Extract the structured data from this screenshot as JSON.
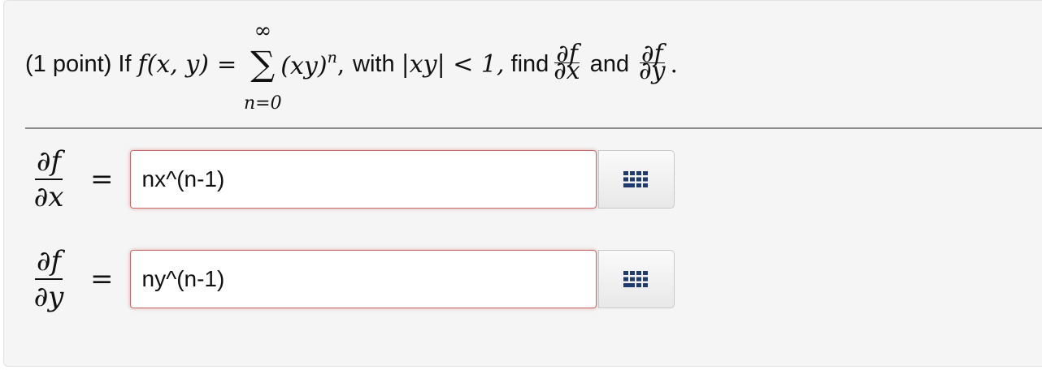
{
  "problem": {
    "points": "(1 point)",
    "if_text": "If",
    "lhs": "f(x, y)",
    "equals": "=",
    "sum_upper": "∞",
    "sum_lower": "n=0",
    "term_base": "(xy)",
    "term_exp": "n",
    "comma": ",",
    "with_text": "with",
    "condition": "|xy| < 1,",
    "find_text": "find",
    "and_text": "and",
    "period": ".",
    "frac_x": {
      "num": "∂f",
      "den": "∂x"
    },
    "frac_y": {
      "num": "∂f",
      "den": "∂y"
    }
  },
  "answers": [
    {
      "label_num": "∂f",
      "label_den": "∂x",
      "equals": "=",
      "value": "nx^(n-1)",
      "palette_icon": "equation-editor-grid-icon"
    },
    {
      "label_num": "∂f",
      "label_den": "∂y",
      "equals": "=",
      "value": "ny^(n-1)",
      "palette_icon": "equation-editor-grid-icon"
    }
  ],
  "colors": {
    "panel_bg": "#f5f5f5",
    "input_error_border": "#c96a6a",
    "divider": "#8c8c8c"
  }
}
